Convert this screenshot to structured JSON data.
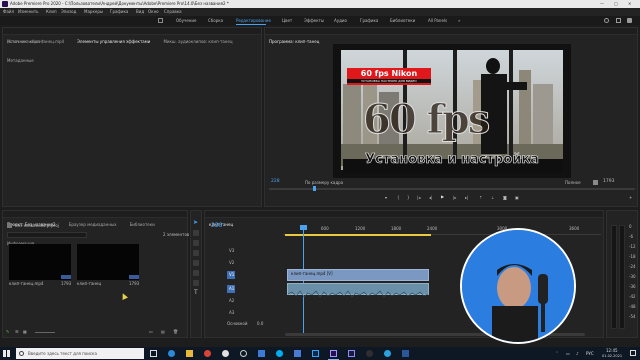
{
  "app_title": "Adobe Premiere Pro 2020 - C:\\Пользователи\\Андрей\\Документы\\Adobe\\Premiere Pro\\14.0\\Без названия2 *",
  "menu": [
    "Файл",
    "Изменить",
    "Клип",
    "Эпизод",
    "Маркеры",
    "Графика",
    "Вид",
    "Окно",
    "Справка"
  ],
  "workspaces": [
    "Обучение",
    "Сборка",
    "Редактирование",
    "Цвет",
    "Эффекты",
    "Аудио",
    "Графика",
    "Библиотеки",
    "All Panels"
  ],
  "workspace_active_index": 2,
  "source_panel": {
    "tabs": [
      "Источник: клип-танец.mp4",
      "Элементы управления эффектами",
      "Микш. аудиоклипов: клип-танец",
      "Метаданные"
    ],
    "status_text": "(клип не выбран)"
  },
  "program_panel": {
    "title": "Программа: клип-танец",
    "timecode": "228",
    "fit_label": "По размеру кадра",
    "quality_label": "Полное",
    "duration": "1793",
    "overlay_badge": "60 fps Nikon",
    "overlay_sub": "УСТАНОВКА НАСТРОЕК ДЛЯ ВИДЕО",
    "overlay_big": "60 fps",
    "overlay_bottom": "Установка и настройка"
  },
  "project_panel": {
    "tabs": [
      "Проект: Без названия2",
      "Браузер медиаданных",
      "Библиотеки",
      "Информация"
    ],
    "file_label": "Без названия2.prproj",
    "items_count": "2 элементов",
    "items": [
      {
        "name": "клип-танец.mp4",
        "duration": "1793"
      },
      {
        "name": "клип-танец",
        "duration": "1793"
      }
    ]
  },
  "timeline": {
    "tab_label": "клип-танец",
    "timecode": "228",
    "ruler_labels": [
      "600",
      "1200",
      "1800",
      "2400",
      "3000",
      "3600"
    ],
    "video_tracks": [
      "V3",
      "V2",
      "V1"
    ],
    "audio_tracks": [
      "A1",
      "A2",
      "A3"
    ],
    "master_label": "Основной",
    "master_value": "0.0",
    "clip_v1": "клип-танец.mp4 [V]",
    "playhead_ratio": 0.12
  },
  "taskbar": {
    "search_placeholder": "Введите здесь текст для поиска",
    "lang": "РУС",
    "time": "12:45",
    "date": "01.02.2021"
  },
  "meter_labels": [
    "0",
    "-6",
    "-12",
    "-18",
    "-24",
    "-30",
    "-36",
    "-42",
    "-48",
    "-54"
  ],
  "colors": {
    "accent_blue": "#2d8ceb",
    "red_badge": "#e0181c",
    "webcam_bg": "#1e6fd9"
  }
}
